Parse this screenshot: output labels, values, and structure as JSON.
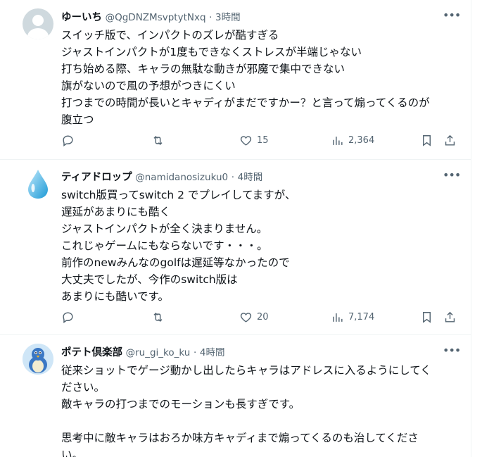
{
  "tweets": [
    {
      "name": "ゆーいち",
      "handle": "@QgDNZMsvptytNxq",
      "dot": "·",
      "time": "3時間",
      "avatar": "default-avatar",
      "lines": [
        "スイッチ版で、インパクトのズレが酷すぎる",
        "ジャストインパクトが1度もできなくストレスが半端じゃない",
        "打ち始める際、キャラの無駄な動きが邪魔で集中できない",
        "旗がないので風の予想がつきにくい",
        "打つまでの時間が長いとキャディがまだですかー？と言って煽ってくるのが",
        "腹立つ"
      ],
      "likes": "15",
      "views": "2,364"
    },
    {
      "name": "ティアドロップ",
      "handle": "@namidanosizuku0",
      "dot": "·",
      "time": "4時間",
      "avatar": "water-drop-avatar",
      "lines": [
        "switch版買ってswitch 2 でプレイしてますが、",
        "遅延があまりにも酷く",
        "ジャストインパクトが全く決まりません。",
        "これじゃゲームにもならないです・・・。",
        "前作のnewみんなのgolfは遅延等なかったので",
        "大丈夫でしたが、今作のswitch版は",
        "あまりにも酷いです。"
      ],
      "likes": "20",
      "views": "7,174"
    },
    {
      "name": "ポテト倶楽部",
      "handle": "@ru_gi_ko_ku",
      "dot": "·",
      "time": "4時間",
      "avatar": "penguin-avatar",
      "lines": [
        "従来ショットでゲージ動かし出したらキャラはアドレスに入るようにしてく",
        "ださい。",
        "敵キャラの打つまでのモーションも長すぎです。",
        "",
        "思考中に敵キャラはおろか味方キャディまで煽ってくるのも治してくださ",
        "い。"
      ]
    }
  ],
  "more_icon": "more-horizontal-icon",
  "colors": {
    "text": "#0f1419",
    "muted": "#536471",
    "border": "#eff3f4"
  }
}
